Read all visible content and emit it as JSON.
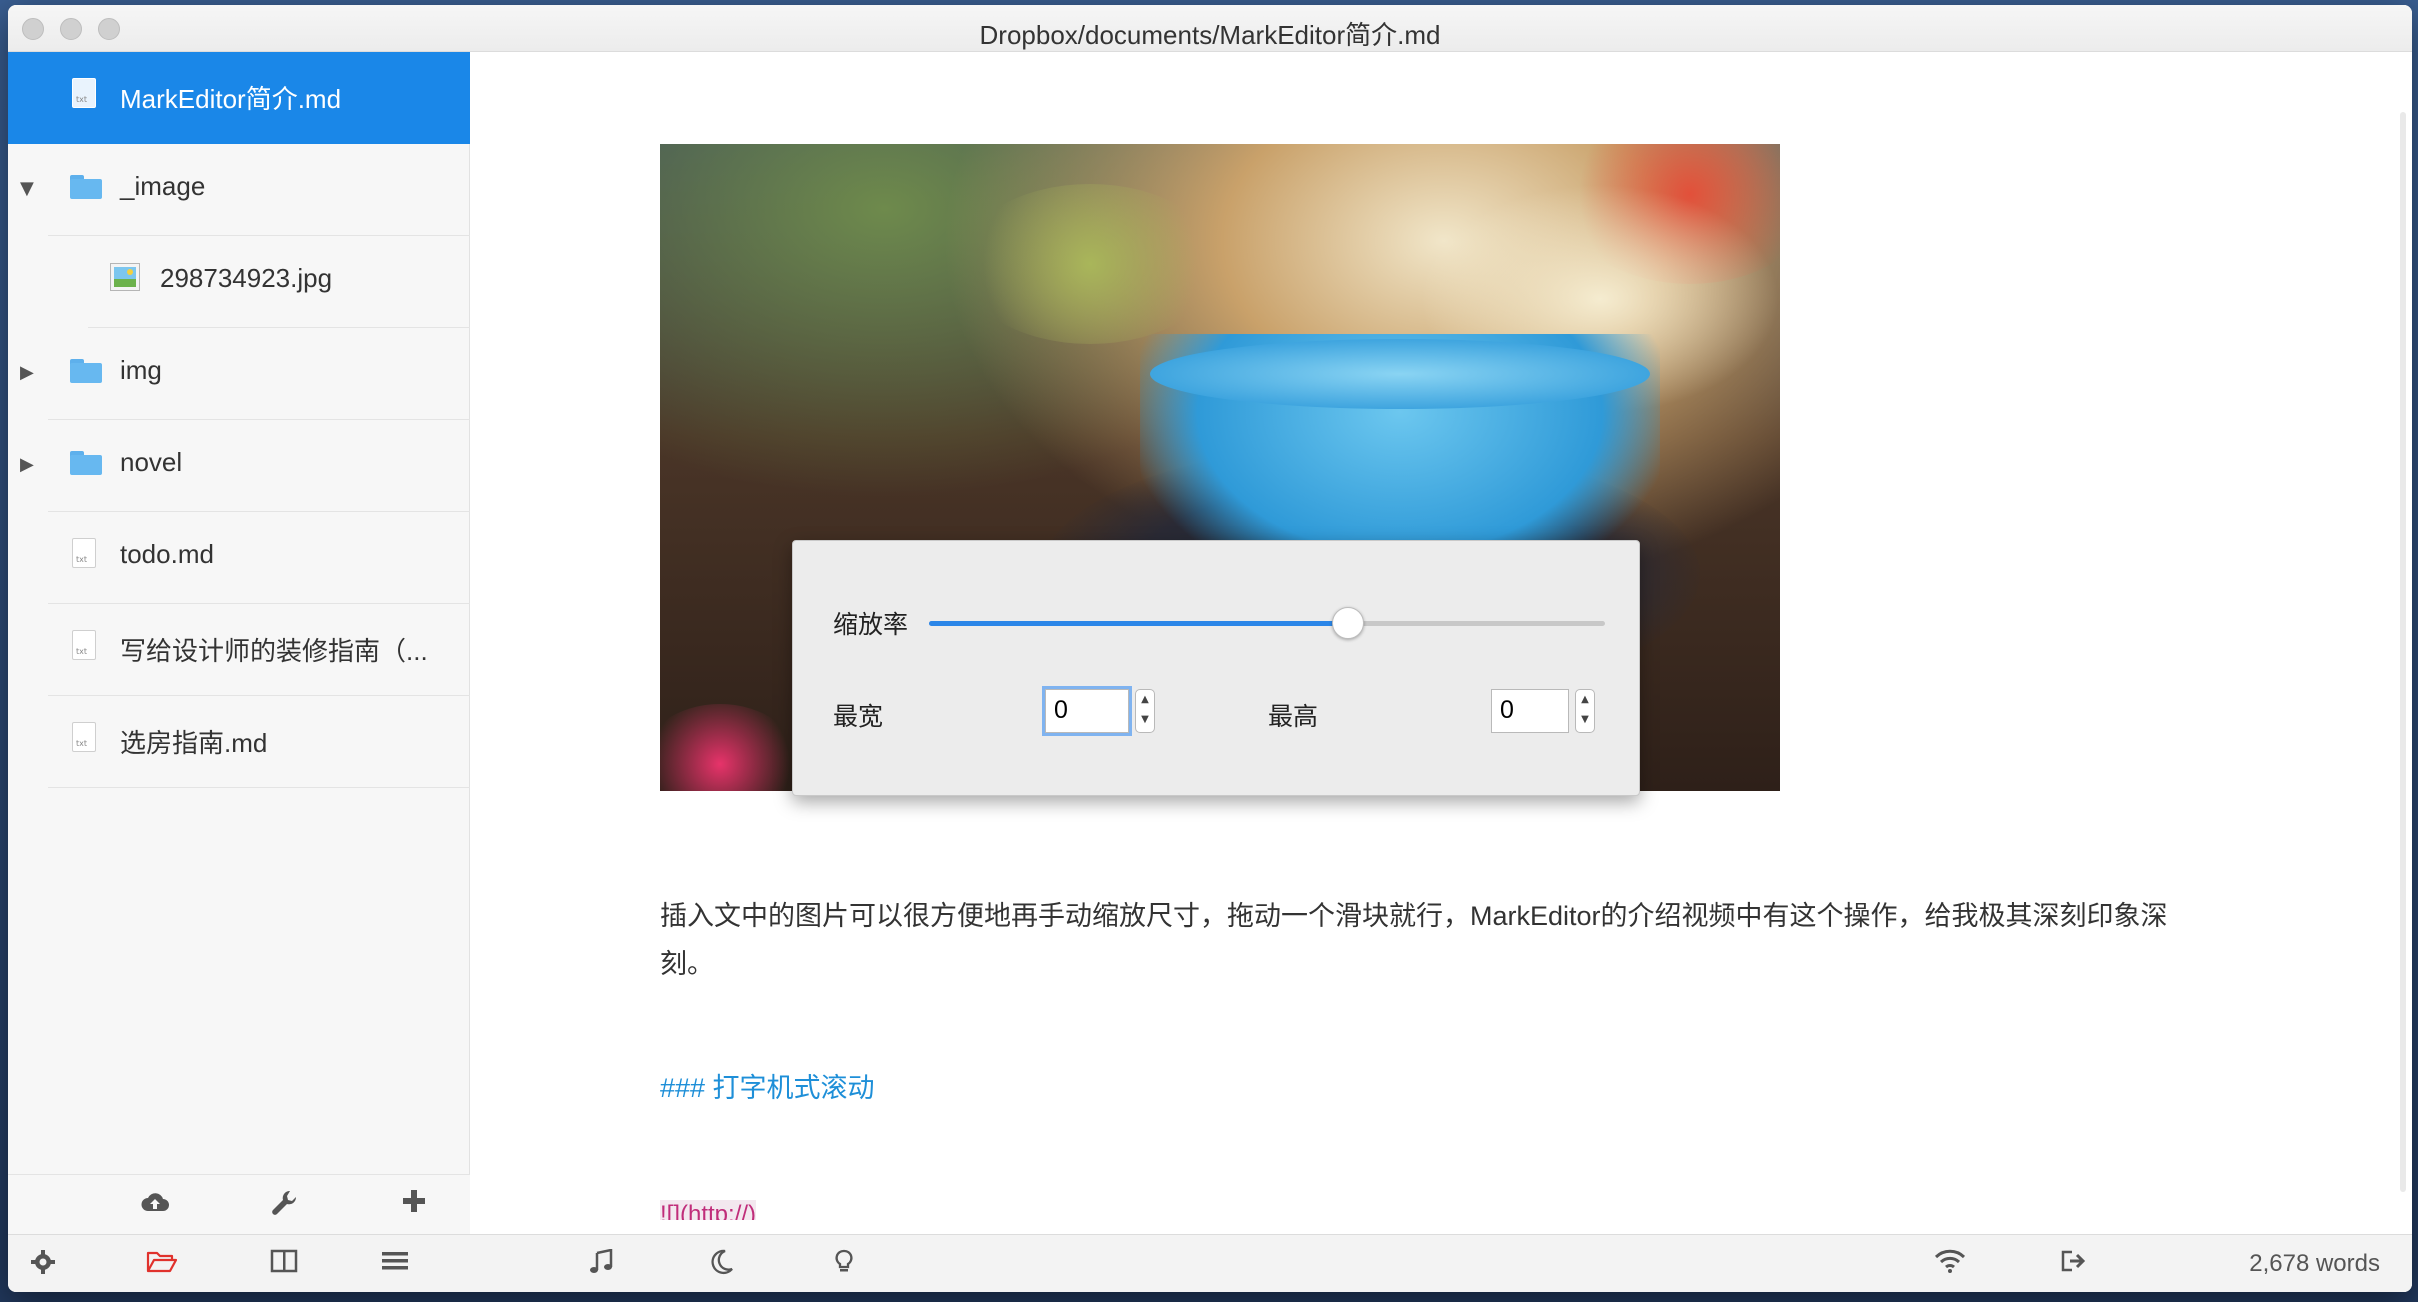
{
  "window": {
    "title": "Dropbox/documents/MarkEditor简介.md"
  },
  "sidebar": {
    "items": [
      {
        "label": "MarkEditor简介.md",
        "kind": "file",
        "active": true
      },
      {
        "label": "_image",
        "kind": "folder",
        "expanded": true
      },
      {
        "label": "298734923.jpg",
        "kind": "image"
      },
      {
        "label": "img",
        "kind": "folder",
        "expanded": false
      },
      {
        "label": "novel",
        "kind": "folder",
        "expanded": false
      },
      {
        "label": "todo.md",
        "kind": "file"
      },
      {
        "label": "写给设计师的装修指南（...",
        "kind": "file"
      },
      {
        "label": "选房指南.md",
        "kind": "file"
      }
    ],
    "file_badge": "txt",
    "tools": [
      "cloud-upload-icon",
      "wrench-icon",
      "plus-icon"
    ]
  },
  "statusbar": {
    "word_count": "2,678 words",
    "icons": [
      "gear-icon",
      "folder-open-icon",
      "columns-icon",
      "menu-icon",
      "music-icon",
      "moon-icon",
      "lightbulb-icon",
      "wifi-icon",
      "sign-out-icon"
    ],
    "accent_color": "#e0312c"
  },
  "popover": {
    "scale_label": "缩放率",
    "scale_value": 0.62,
    "max_width_label": "最宽",
    "max_width_value": "0",
    "max_height_label": "最高",
    "max_height_value": "0"
  },
  "editor": {
    "paragraph": "插入文中的图片可以很方便地再手动缩放尺寸，拖动一个滑块就行，MarkEditor的介绍视频中有这个操作，给我极其深刻印象深刻。",
    "heading": "### 打字机式滚动",
    "link_fragment": "![](http://)"
  },
  "colors": {
    "accent": "#1a87e8",
    "heading": "#1e8fd8"
  }
}
